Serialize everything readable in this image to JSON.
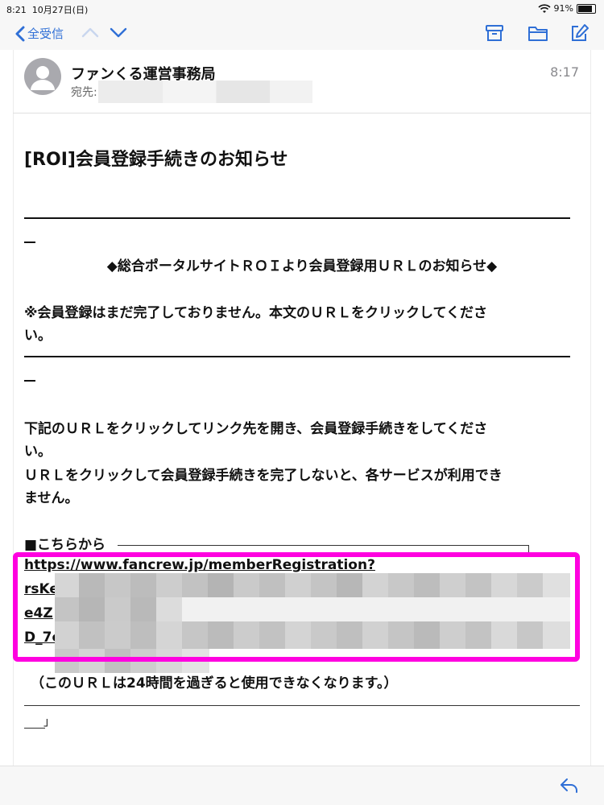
{
  "status_bar": {
    "time": "8:21",
    "date": "10月27日(日)",
    "battery": "91%",
    "battery_level": 0.91
  },
  "nav": {
    "back_label": "全受信"
  },
  "email": {
    "sender": "ファンくる運営事務局",
    "to_label": "宛先:",
    "time": "8:17",
    "subject": "[ROI]会員登録手続きのお知らせ",
    "announce": "◆総合ポータルサイトＲＯＩより会員登録用ＵＲＬのお知らせ◆",
    "notice_line1": "※会員登録はまだ完了しておりません。本文のＵＲＬをクリックしてくださ",
    "notice_line2": "い。",
    "instr_line1": "下記のＵＲＬをクリックしてリンク先を開き、会員登録手続きをしてくださ",
    "instr_line2": "い。",
    "instr_line3": "ＵＲＬをクリックして会員登録手続きを完了しないと、各サービスが利用でき",
    "instr_line4": "ません。",
    "from_here": "■こちらから",
    "url_line1": "https://www.fancrew.jp/memberRegistration?",
    "url_line2": "rsKe",
    "url_line3": "e4Z",
    "url_line4": "D_7c",
    "validity": "（このＵＲＬは24時間を過ぎると使用できなくなります。）",
    "bracket": "」"
  },
  "colors": {
    "accent": "#2f6fd6",
    "highlight": "#ff00e0"
  }
}
